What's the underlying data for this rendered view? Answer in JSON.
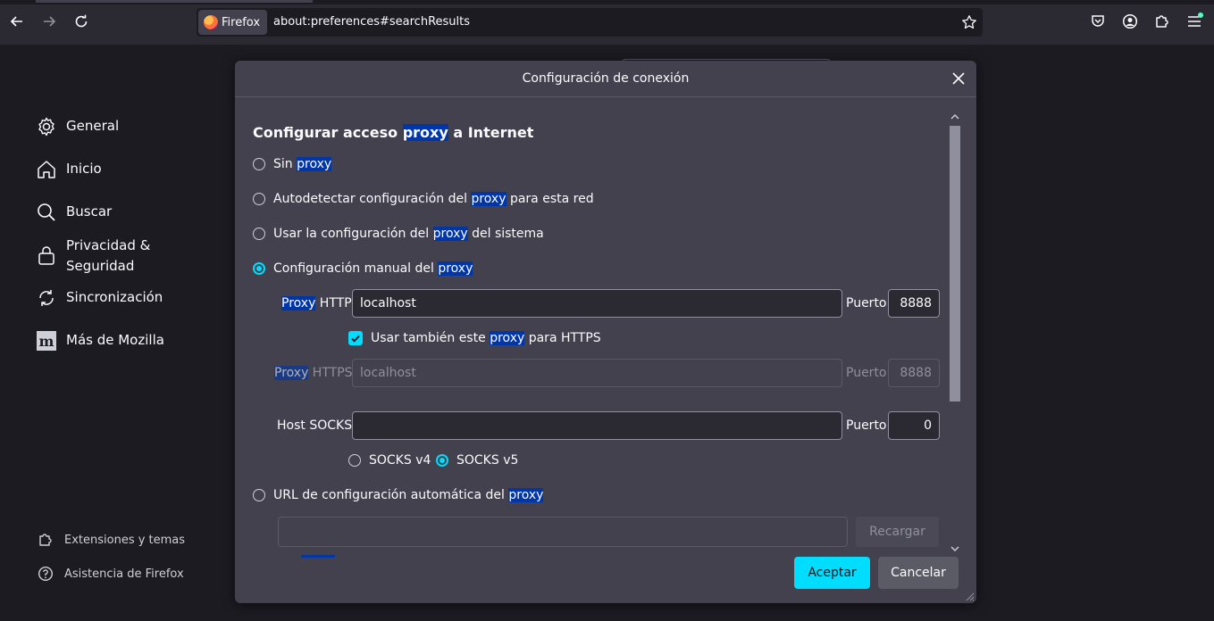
{
  "browser": {
    "identity_label": "Firefox",
    "url": "about:preferences#searchResults"
  },
  "sidebar": {
    "items": [
      {
        "label": "General",
        "icon": "gear-icon"
      },
      {
        "label": "Inicio",
        "icon": "home-icon"
      },
      {
        "label": "Buscar",
        "icon": "search-icon"
      },
      {
        "label": "Privacidad &",
        "label2": "Seguridad",
        "icon": "lock-icon"
      },
      {
        "label": "Sincronización",
        "icon": "sync-icon"
      },
      {
        "label": "Más de Mozilla",
        "icon": "mozilla-icon"
      }
    ],
    "footer": [
      {
        "label": "Extensiones y temas",
        "icon": "puzzle-icon"
      },
      {
        "label": "Asistencia de Firefox",
        "icon": "help-icon"
      }
    ]
  },
  "dialog": {
    "title": "Configuración de conexión",
    "heading": {
      "pre": "Configurar acceso ",
      "hl": "proxy",
      "post": " a Internet"
    },
    "options": {
      "no_proxy": {
        "pre": "Sin ",
        "hl": "proxy"
      },
      "auto_detect": {
        "pre": "Autodetectar configuración del ",
        "hl": "proxy",
        "post": " para esta red"
      },
      "system": {
        "pre": "Usar la configuración del ",
        "hl": "proxy",
        "post": " del sistema"
      },
      "manual": {
        "pre": "Configuración manual del ",
        "hl": "proxy"
      },
      "auto_url": {
        "pre": "URL de configuración automática del ",
        "hl": "proxy"
      }
    },
    "selected_option": "manual",
    "http": {
      "label_hl": "Proxy",
      "label_post": " HTTP",
      "value": "localhost",
      "port_label": "Puerto",
      "port": "8888"
    },
    "also_https": {
      "pre": "Usar también este ",
      "hl": "proxy",
      "post": " para HTTPS",
      "checked": true
    },
    "https": {
      "label_hl": "Proxy",
      "label_post": " HTTPS",
      "value": "localhost",
      "port_label": "Puerto",
      "port": "8888"
    },
    "socks": {
      "label": "Host SOCKS",
      "value": "",
      "port_label": "Puerto",
      "port": "0"
    },
    "socks_versions": [
      {
        "label": "SOCKS v4",
        "selected": false
      },
      {
        "label": "SOCKS v5",
        "selected": true
      }
    ],
    "auto_url_value": "",
    "reload_label": "Recargar",
    "accept_label": "Aceptar",
    "cancel_label": "Cancelar"
  },
  "colors": {
    "accent": "#00ddff",
    "highlight": "#0036a8",
    "dialog_bg": "#42414d",
    "page_bg": "#1c1b22"
  }
}
